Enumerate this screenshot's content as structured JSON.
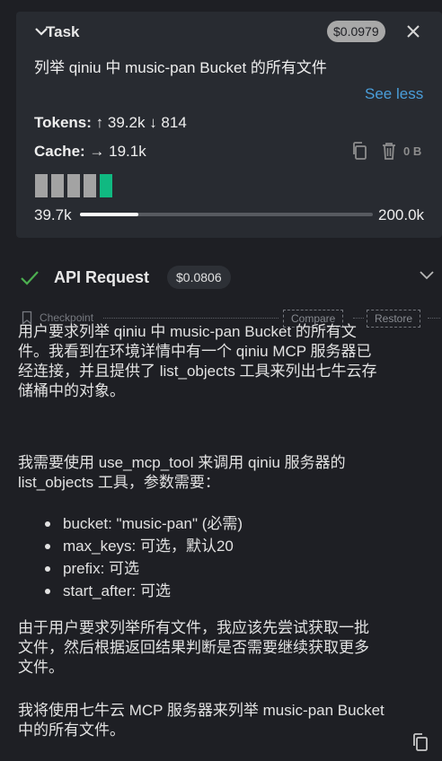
{
  "task": {
    "header_label": "Task",
    "cost": "$0.0979",
    "text": "列举 qiniu 中 music-pan Bucket 的所有文件",
    "see_less": "See less",
    "tokens_label": "Tokens:",
    "tokens_in": "↑ 39.2k",
    "tokens_out": "↓ 814",
    "cache_label": "Cache:",
    "cache_value": "→ 19.1k",
    "storage_size": "0 B",
    "context_used": "39.7k",
    "context_total": "200.0k",
    "context_progress": 0.1985,
    "segment_colors": [
      "#a3a3a3",
      "#a3a3a3",
      "#a3a3a3",
      "#a3a3a3",
      "#10b981"
    ]
  },
  "api": {
    "title": "API Request",
    "cost": "$0.0806"
  },
  "checkpoint": {
    "label": "Checkpoint",
    "compare": "Compare",
    "restore": "Restore"
  },
  "message": {
    "p1_lines": [
      "用户要求列举 qiniu 中 music-pan Bucket 的所有文",
      "件。我看到在环境详情中有一个 qiniu MCP 服务器已",
      "经连接，并且提供了 list_objects 工具来列出七牛云存",
      "储桶中的对象。"
    ],
    "p2_lines": [
      "我需要使用 use_mcp_tool 来调用 qiniu 服务器的",
      "list_objects 工具，参数需要："
    ],
    "bullets": [
      "bucket: \"music-pan\" (必需)",
      "max_keys: 可选，默认20",
      "prefix: 可选",
      "start_after: 可选"
    ],
    "p3_lines": [
      "由于用户要求列举所有文件，我应该先尝试获取一批",
      "文件，然后根据返回结果判断是否需要继续获取更多",
      "文件。"
    ],
    "p4_lines": [
      "我将使用七牛云 MCP 服务器来列举 music-pan Bucket",
      "中的所有文件。"
    ]
  },
  "colors": {
    "accent_link": "#4a9eda",
    "success": "#10b981",
    "check": "#4caf50"
  }
}
